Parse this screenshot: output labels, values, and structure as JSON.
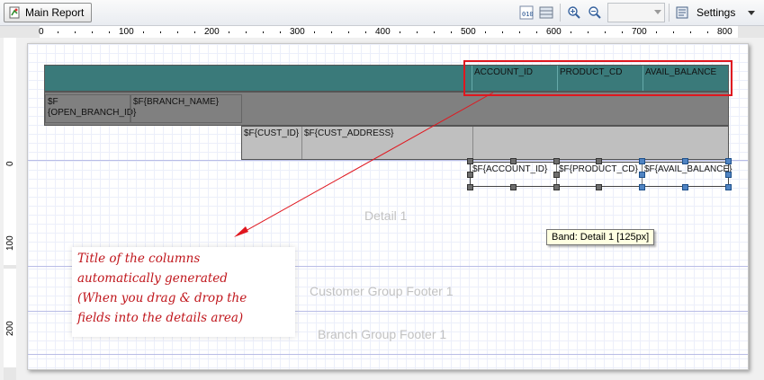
{
  "toolbar": {
    "tab_label": "Main Report",
    "settings_label": "Settings",
    "zoom_value": ""
  },
  "ruler": {
    "h_labels": [
      "0",
      "100",
      "200",
      "300",
      "400",
      "500",
      "600",
      "700",
      "800"
    ],
    "v_labels": [
      "0",
      "100",
      "200"
    ]
  },
  "bands": {
    "column_header_cells": [
      "ACCOUNT_ID",
      "PRODUCT_CD",
      "AVAIL_BALANCE"
    ],
    "branch_cells": [
      "$F {OPEN_BRANCH_ID}",
      "$F{BRANCH_NAME}"
    ],
    "customer_cells": [
      "$F{CUST_ID}",
      "$F{CUST_ADDRESS}"
    ],
    "detail_cells": [
      "$F{ACCOUNT_ID}",
      "$F{PRODUCT_CD}",
      "$F{AVAIL_BALANCE}"
    ],
    "labels": {
      "detail": "Detail 1",
      "customer_footer": "Customer Group Footer 1",
      "branch_footer": "Branch Group Footer 1"
    }
  },
  "tooltip": "Band: Detail 1 [125px]",
  "annotation": {
    "lines": [
      "Title of the columns",
      "automatically generated",
      "(When you drag & drop the",
      "fields into the details area)"
    ]
  },
  "colors": {
    "header_band": "#3a7a7a",
    "branch_band": "#808080",
    "customer_band": "#bfbfbf",
    "annotation": "#e0171f"
  }
}
